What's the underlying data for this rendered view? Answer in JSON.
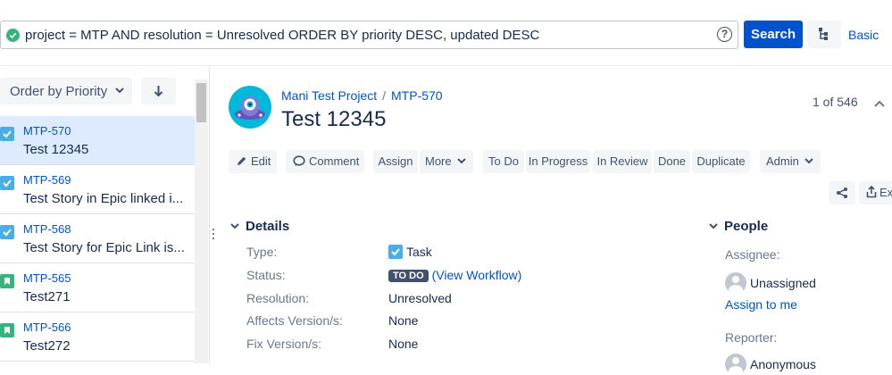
{
  "search": {
    "query": "project = MTP AND resolution = Unresolved ORDER BY priority DESC, updated DESC",
    "search_label": "Search",
    "basic_label": "Basic",
    "help_label": "?"
  },
  "sidebar": {
    "order_by_label": "Order by Priority",
    "items": [
      {
        "key": "MTP-570",
        "summary": "Test 12345",
        "type": "task",
        "selected": true
      },
      {
        "key": "MTP-569",
        "summary": "Test Story in Epic linked i...",
        "type": "task"
      },
      {
        "key": "MTP-568",
        "summary": "Test Story for Epic Link is...",
        "type": "task"
      },
      {
        "key": "MTP-565",
        "summary": "Test271",
        "type": "story"
      },
      {
        "key": "MTP-566",
        "summary": "Test272",
        "type": "story"
      }
    ]
  },
  "issue": {
    "project": "Mani Test Project",
    "separator": "/",
    "key": "MTP-570",
    "title": "Test 12345",
    "pager": "1 of 546"
  },
  "toolbar": {
    "edit": "Edit",
    "comment": "Comment",
    "assign": "Assign",
    "more": "More",
    "todo": "To Do",
    "in_progress": "In Progress",
    "in_review": "In Review",
    "done": "Done",
    "duplicate": "Duplicate",
    "admin": "Admin",
    "export": "Ex"
  },
  "details": {
    "heading": "Details",
    "type_label": "Type:",
    "type_value": "Task",
    "status_label": "Status:",
    "status_value": "TO DO",
    "view_workflow": "(View Workflow)",
    "resolution_label": "Resolution:",
    "resolution_value": "Unresolved",
    "affects_label": "Affects Version/s:",
    "affects_value": "None",
    "fix_label": "Fix Version/s:",
    "fix_value": "None"
  },
  "people": {
    "heading": "People",
    "assignee_label": "Assignee:",
    "assignee_value": "Unassigned",
    "assign_to_me": "Assign to me",
    "reporter_label": "Reporter:",
    "reporter_value": "Anonymous"
  },
  "colors": {
    "primary": "#0052cc",
    "task": "#4bade8",
    "story": "#36b37e",
    "selected_row": "#deebff",
    "status_lozenge": "#42526e",
    "valid_query": "#36b37e"
  }
}
